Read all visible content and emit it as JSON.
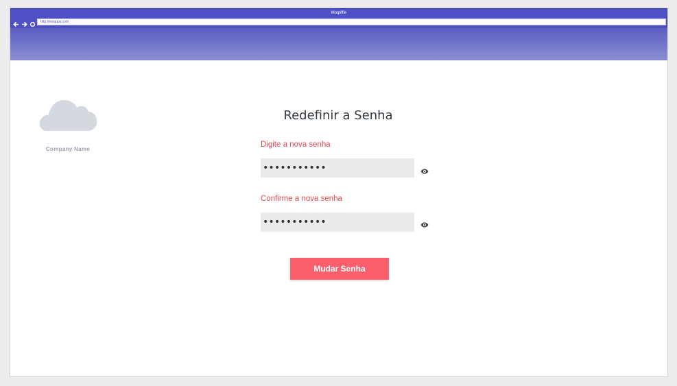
{
  "browser": {
    "title": "Moqtiffle",
    "url": "http://moqups.com"
  },
  "brand": {
    "company_name": "Company Name"
  },
  "form": {
    "title": "Redefinir a Senha",
    "new_password_label": "Digite a nova senha",
    "new_password_value": "•••••••••••",
    "confirm_password_label": "Confirme a nova senha",
    "confirm_password_value": "•••••••••••",
    "submit_label": "Mudar Senha"
  },
  "colors": {
    "accent": "#fa5f6c",
    "label": "#e04a52",
    "header": "#4f4fc6"
  }
}
